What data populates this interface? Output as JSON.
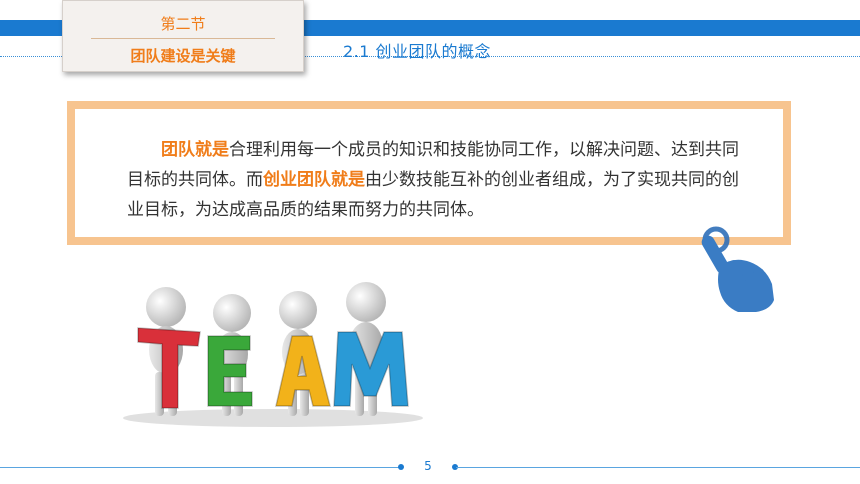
{
  "header": {
    "section_number": "第二节",
    "section_title": "团队建设是关键",
    "subsection_title": "2.1  创业团队的概念"
  },
  "definition": {
    "term1": "团队就是",
    "part1": "合理利用每一个成员的知识和技能协同工作，以解决问题、达到共同目标的共同体。而",
    "term2": "创业团队就是",
    "part2": "由少数技能互补的创业者组成，为了实现共同的创业目标，为达成高品质的结果而努力的共同体。"
  },
  "illustration": {
    "letters": [
      "T",
      "E",
      "A",
      "M"
    ]
  },
  "footer": {
    "page_number": "5"
  },
  "colors": {
    "accent_blue": "#1a7ad0",
    "accent_orange": "#f07d1a",
    "box_border": "#f7c48f",
    "letter_T": "#d9303a",
    "letter_E": "#3aa83a",
    "letter_A": "#f2b21a",
    "letter_M": "#2a9ad6"
  },
  "icons": [
    "pointing-hand-icon",
    "team-people-icon"
  ]
}
